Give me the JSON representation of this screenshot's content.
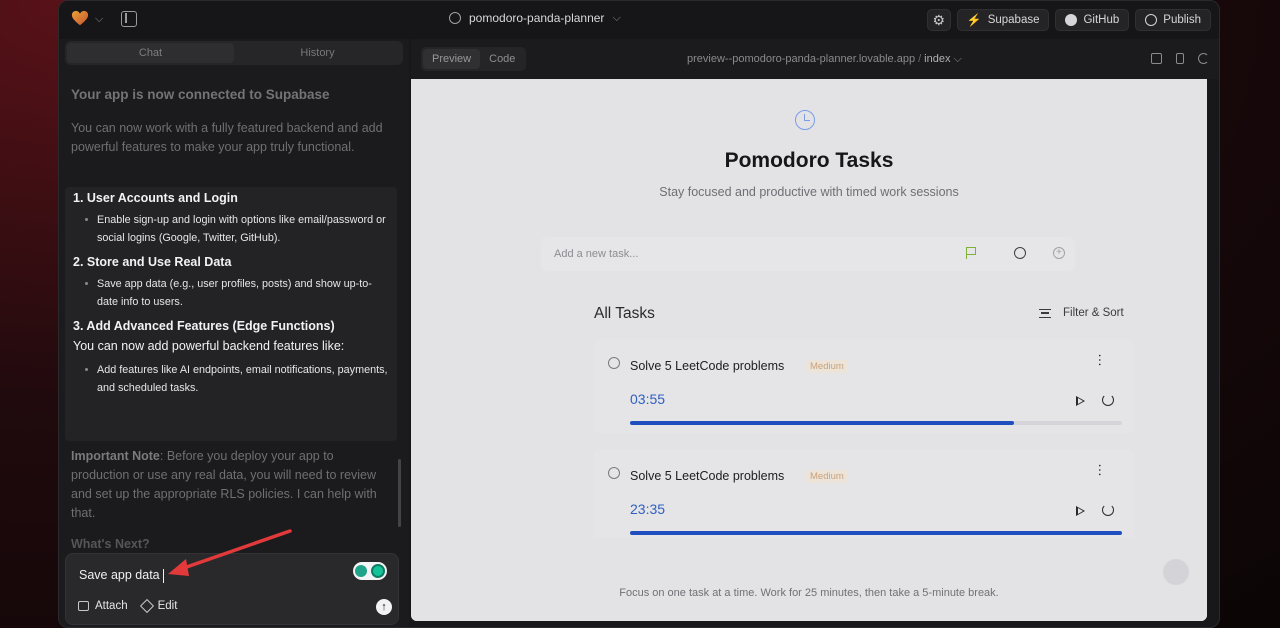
{
  "topbar": {
    "project_name": "pomodoro-panda-planner",
    "buttons": {
      "supabase": "Supabase",
      "github": "GitHub",
      "publish": "Publish"
    },
    "icons": [
      "heart-logo-icon",
      "chevron-down-icon",
      "sidebar-toggle-icon",
      "globe-icon",
      "gear-icon",
      "supabase-icon",
      "github-icon",
      "globe-icon"
    ]
  },
  "chat": {
    "tabs": [
      "Chat",
      "History"
    ],
    "active_tab": "Chat",
    "heading": "Your app is now connected to Supabase",
    "intro": "You can now work with a fully featured backend and add powerful features to make your app truly functional.",
    "sections": [
      {
        "title": "1. User Accounts and Login",
        "bullet": "Enable sign-up and login with options like email/password or social logins (Google, Twitter, GitHub)."
      },
      {
        "title": "2. Store and Use Real Data",
        "bullet": "Save app data (e.g., user profiles, posts) and show up-to-date info to users."
      },
      {
        "title": "3. Add Advanced Features (Edge Functions)",
        "lead": "You can now add powerful backend features like:",
        "bullet": "Add features like AI endpoints, email notifications, payments, and scheduled tasks."
      }
    ],
    "note_label": "Important Note",
    "note_text": ": Before you deploy your app to production or use any real data, you will need to review and set up the appropriate RLS policies. I can help with that.",
    "next_heading": "What's Next?",
    "input_value": "Save app data",
    "actions": {
      "attach": "Attach",
      "edit": "Edit"
    }
  },
  "preview": {
    "tabs": [
      "Preview",
      "Code"
    ],
    "active_tab": "Preview",
    "url": "preview--pomodoro-panda-planner.lovable.app",
    "url_sep": "/",
    "page": "index",
    "app": {
      "title": "Pomodoro Tasks",
      "subtitle": "Stay focused and productive with timed work sessions",
      "add_placeholder": "Add a new task...",
      "list_title": "All Tasks",
      "filter_label": "Filter & Sort",
      "tasks": [
        {
          "name": "Solve 5 LeetCode problems",
          "priority": "Medium",
          "time": "03:55",
          "progress": 0.78
        },
        {
          "name": "Solve 5 LeetCode problems",
          "priority": "Medium",
          "time": "23:35",
          "progress": 1.0
        }
      ],
      "footer": "Focus on one task at a time. Work for 25 minutes, then take a 5-minute break."
    }
  },
  "colors": {
    "accent_blue": "#2563eb",
    "progress_fill": "#1f4fbf",
    "supabase_green": "#3ecf8e",
    "annotation_arrow": "#e23a3a",
    "medium_badge": "#caa27a"
  }
}
